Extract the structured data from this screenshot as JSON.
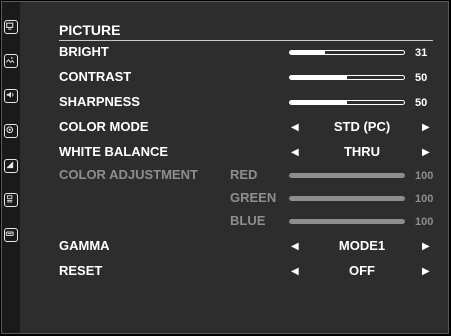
{
  "menu": {
    "title": "PICTURE",
    "sidebar_icons": [
      "monitor-icon",
      "image-icon",
      "audio-icon",
      "settings-icon",
      "display-adjust-icon",
      "info-icon",
      "input-icon"
    ],
    "items": [
      {
        "label": "BRIGHT",
        "type": "slider",
        "value": "31",
        "fill": 0.31
      },
      {
        "label": "CONTRAST",
        "type": "slider",
        "value": "50",
        "fill": 0.5
      },
      {
        "label": "SHARPNESS",
        "type": "slider",
        "value": "50",
        "fill": 0.5
      },
      {
        "label": "COLOR MODE",
        "type": "select",
        "value": "STD (PC)"
      },
      {
        "label": "WHITE BALANCE",
        "type": "select",
        "value": "THRU"
      },
      {
        "label": "COLOR ADJUSTMENT",
        "type": "group",
        "disabled": true,
        "channels": [
          {
            "label": "RED",
            "value": "100",
            "fill": 1.0
          },
          {
            "label": "GREEN",
            "value": "100",
            "fill": 1.0
          },
          {
            "label": "BLUE",
            "value": "100",
            "fill": 1.0
          }
        ]
      },
      {
        "label": "GAMMA",
        "type": "select",
        "value": "MODE1"
      },
      {
        "label": "RESET",
        "type": "select",
        "value": "OFF"
      }
    ],
    "arrow_left": "◀",
    "arrow_right": "▶"
  },
  "colors": {
    "background": "#2d2d2d",
    "text": "#ffffff",
    "disabled_text": "#8e8e8e",
    "sidebar": "#1a1a1a"
  }
}
